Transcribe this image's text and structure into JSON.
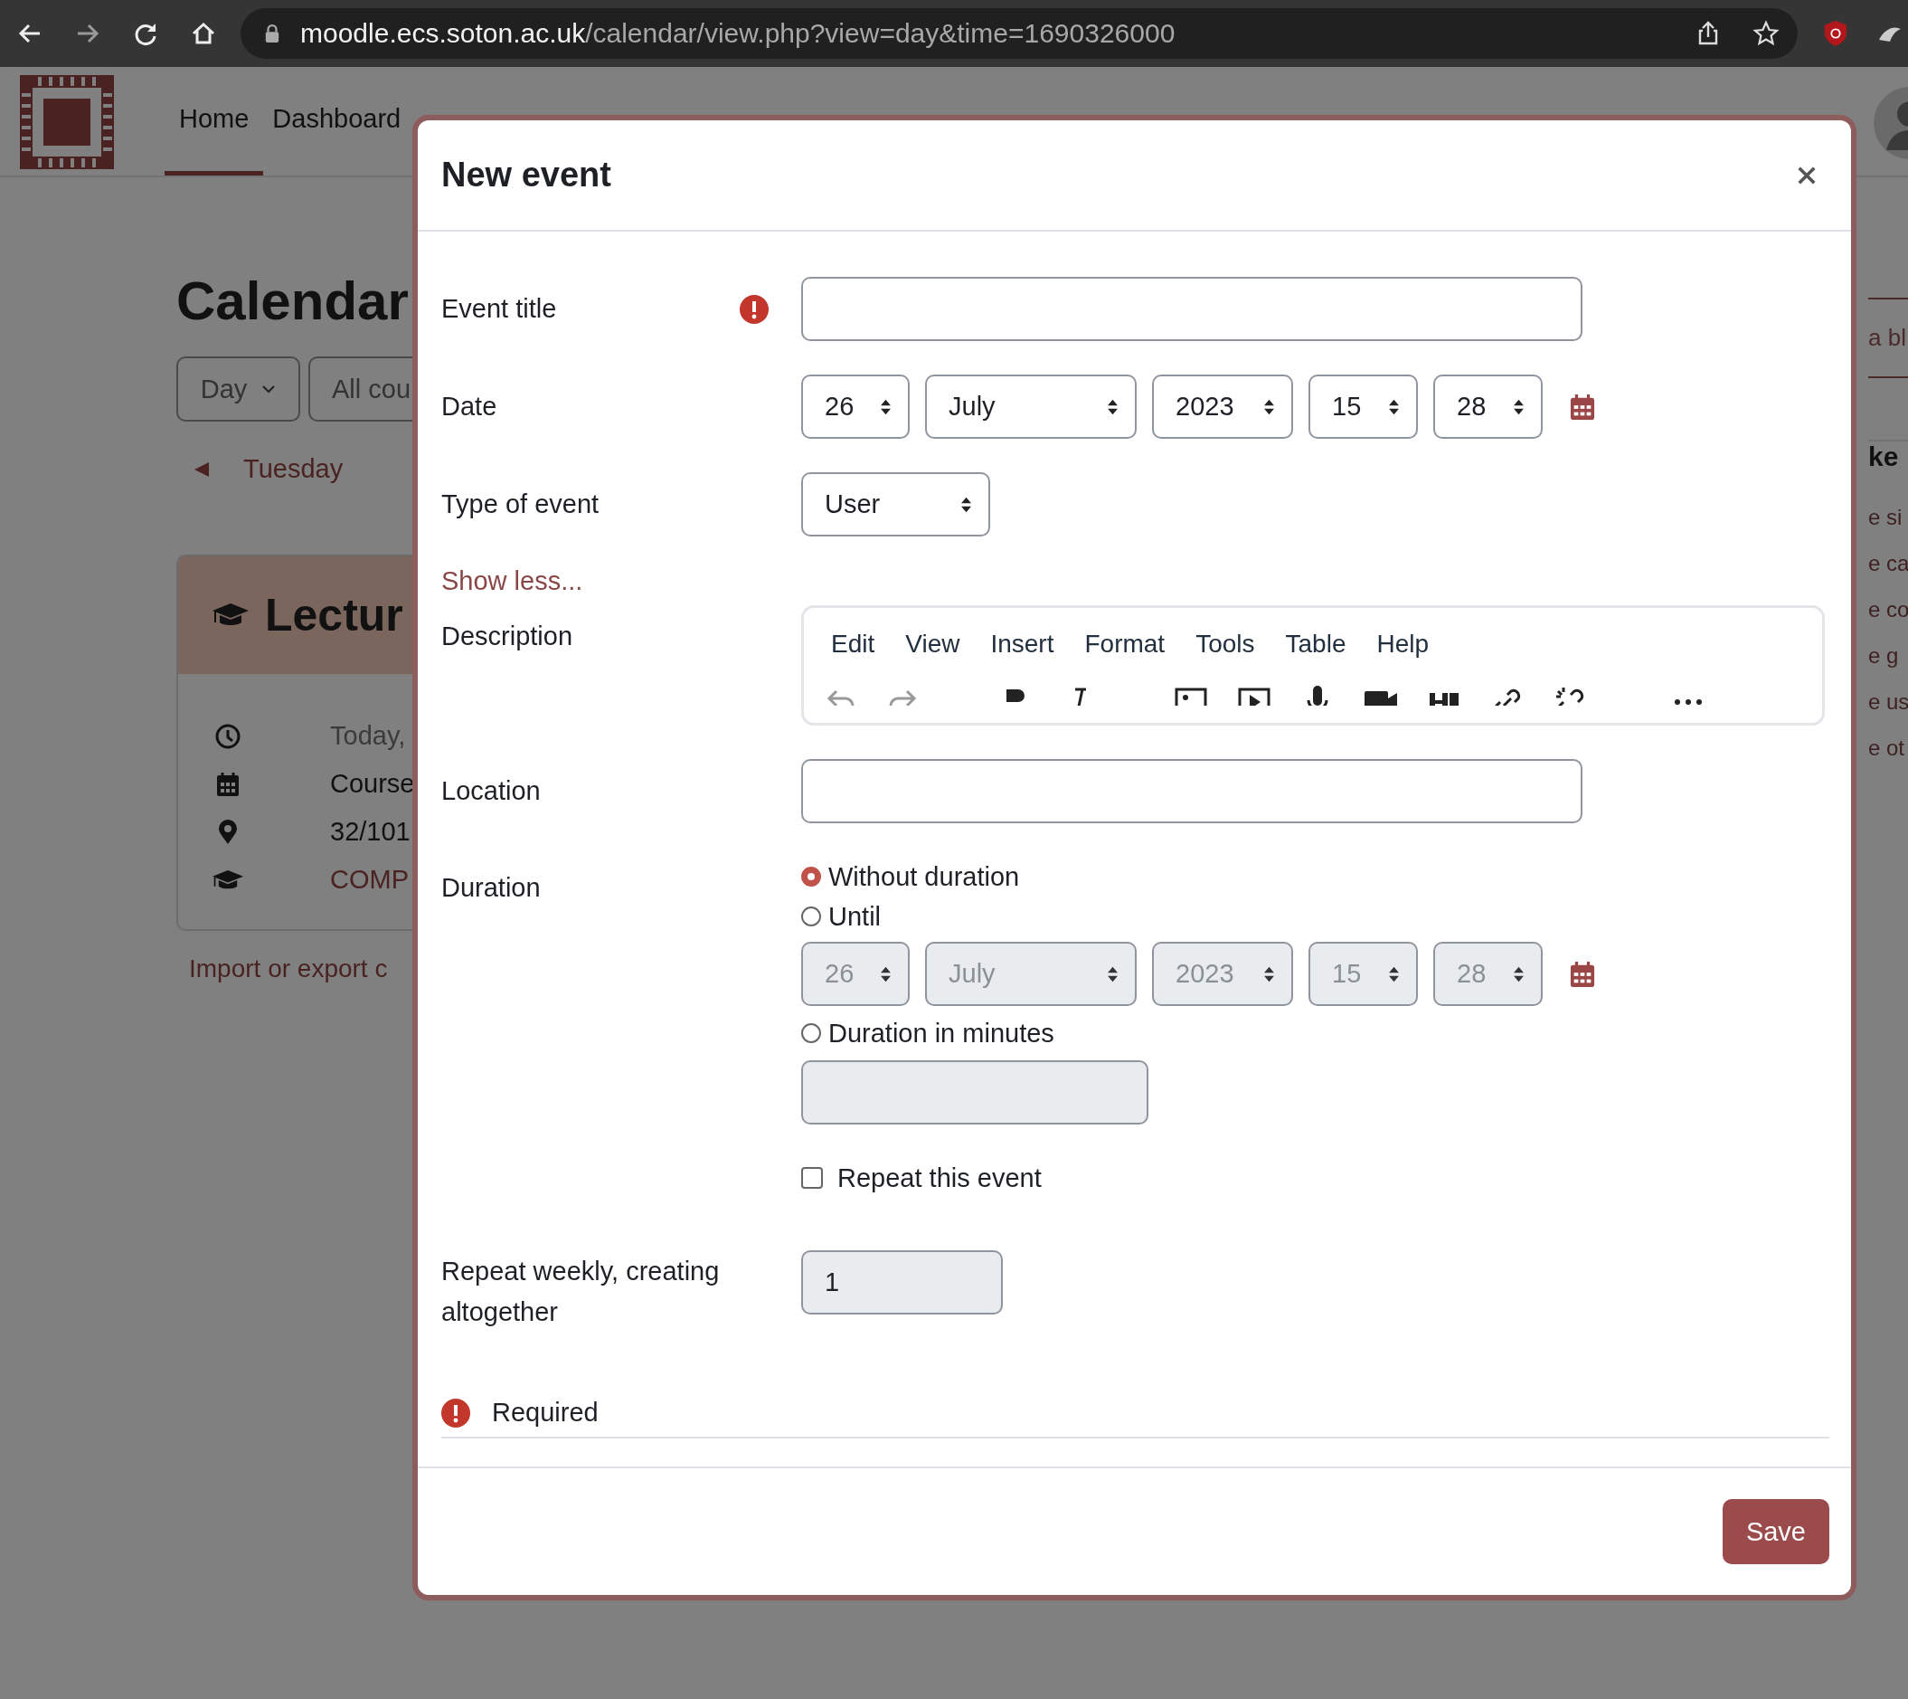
{
  "browser": {
    "host": "moodle.ecs.soton.ac.uk",
    "path": "/calendar/view.php?view=day&time=1690326000"
  },
  "nav": [
    {
      "label": "Home",
      "selected": true
    },
    {
      "label": "Dashboard",
      "selected": false
    }
  ],
  "page": {
    "title": "Calendar",
    "view_filter": "Day",
    "course_filter": "All cou",
    "previous_day": "Tuesday",
    "event": {
      "title": "Lectur",
      "details": [
        {
          "kind": "time",
          "text": "Today,"
        },
        {
          "kind": "date",
          "text": "Course"
        },
        {
          "kind": "place",
          "text": "32/101"
        },
        {
          "kind": "course",
          "text": "COMP"
        }
      ]
    },
    "import_link": "Import or export c"
  },
  "side_block": {
    "button": "a bl",
    "heading": "ke",
    "links": [
      "e si",
      "e ca",
      "e co",
      "e g",
      "e us",
      "e ot"
    ]
  },
  "modal": {
    "title": "New event",
    "event_title": {
      "label": "Event title",
      "required": true
    },
    "date": {
      "label": "Date",
      "selects": [
        "26",
        "July",
        "2023",
        "15",
        "28"
      ]
    },
    "type": {
      "label": "Type of event",
      "value": "User"
    },
    "show_less": "Show less...",
    "description": {
      "label": "Description",
      "menu": [
        "Edit",
        "View",
        "Insert",
        "Format",
        "Tools",
        "Table",
        "Help"
      ]
    },
    "location": {
      "label": "Location"
    },
    "duration": {
      "label": "Duration",
      "options": [
        {
          "label": "Without duration",
          "selected": true
        },
        {
          "label": "Until",
          "selected": false
        },
        {
          "label": "Duration in minutes",
          "selected": false
        }
      ],
      "until": {
        "disabled": true,
        "selects": [
          "26",
          "July",
          "2023",
          "15",
          "28"
        ]
      },
      "minutes_field": {
        "disabled": true
      }
    },
    "repeat": {
      "label": "Repeat this event",
      "checked": false
    },
    "repeat_count": {
      "label": "Repeat weekly, creating altogether",
      "value": "1",
      "disabled": true
    },
    "required_note": "Required",
    "save": "Save"
  }
}
